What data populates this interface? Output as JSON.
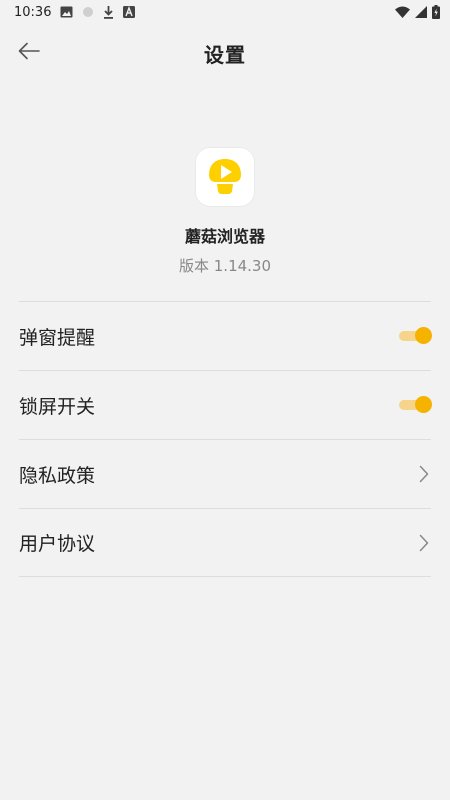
{
  "status_bar": {
    "time": "10:36",
    "left_icons": [
      "image-icon",
      "dot-icon",
      "download-icon",
      "font-a-icon"
    ],
    "right_icons": [
      "wifi-icon",
      "signal-icon",
      "battery-charging-icon"
    ]
  },
  "header": {
    "title": "设置",
    "back_icon": "arrow-left-icon"
  },
  "app": {
    "name": "蘑菇浏览器",
    "version": "版本 1.14.30",
    "logo_color": "#ffd000"
  },
  "settings": {
    "popup_reminder": {
      "label": "弹窗提醒",
      "enabled": true
    },
    "lock_screen": {
      "label": "锁屏开关",
      "enabled": true
    },
    "privacy_policy": {
      "label": "隐私政策"
    },
    "user_agreement": {
      "label": "用户协议"
    }
  },
  "colors": {
    "accent": "#f5b300",
    "background": "#f2f2f2",
    "divider": "#dddddd"
  }
}
